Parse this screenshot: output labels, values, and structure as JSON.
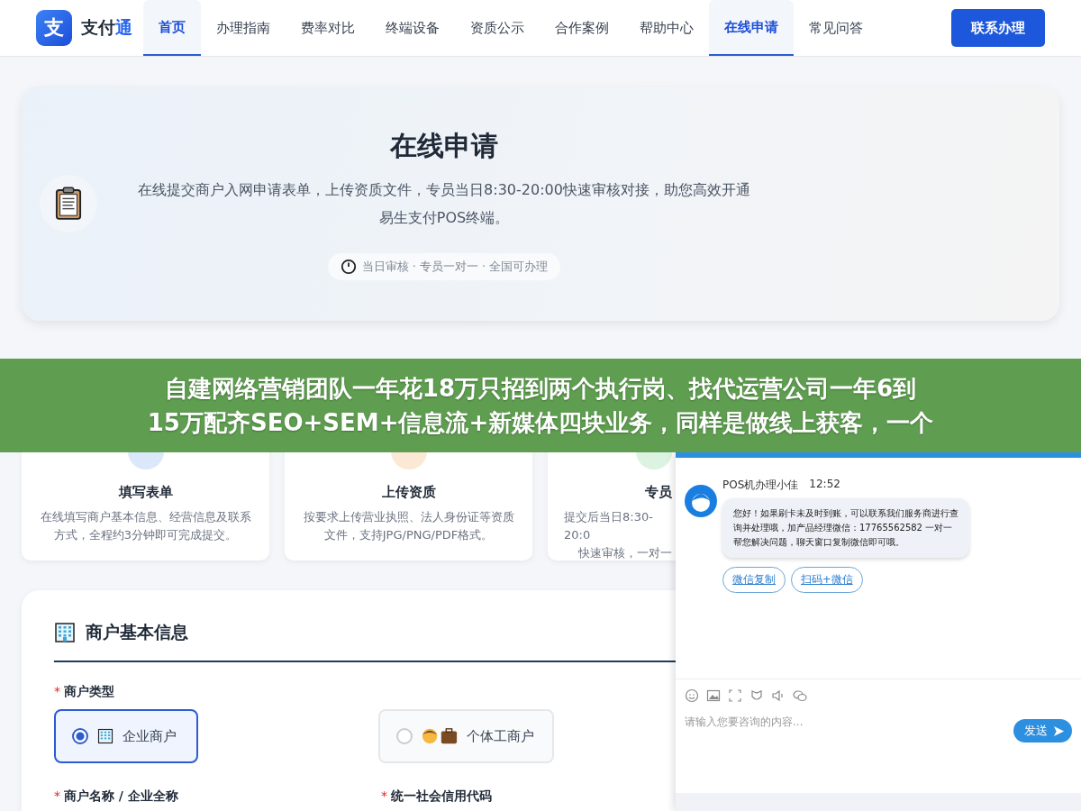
{
  "header": {
    "logo_mark": "支",
    "brand": "支付",
    "brand_accent": "通",
    "nav": [
      {
        "label": "首页",
        "selected": true
      },
      {
        "label": "办理指南",
        "selected": false
      },
      {
        "label": "费率对比",
        "selected": false
      },
      {
        "label": "终端设备",
        "selected": false
      },
      {
        "label": "资质公示",
        "selected": false
      },
      {
        "label": "合作案例",
        "selected": false
      },
      {
        "label": "帮助中心",
        "selected": false
      },
      {
        "label": "在线申请",
        "selected": true
      },
      {
        "label": "常见问答",
        "selected": false
      }
    ],
    "cta": "联系办理"
  },
  "hero": {
    "title": "在线申请",
    "description": "在线提交商户入网申请表单，上传资质文件，专员当日8:30-20:00快速审核对接，助您高效开通易生支付POS终端。",
    "pill": "当日审核 · 专员一对一 · 全国可办理"
  },
  "process": {
    "steps": [
      {
        "color": "#dbe8fb",
        "title": "填写表单",
        "description": "在线填写商户基本信息、经营信息及联系方式，全程约3分钟即可完成提交。"
      },
      {
        "color": "#fbe9d6",
        "title": "上传资质",
        "description": "按要求上传营业执照、法人身份证等资质文件，支持JPG/PNG/PDF格式。"
      },
      {
        "color": "#dcf3e2",
        "title": "专员",
        "description_lines": [
          "提交后当日8:30-20:0",
          "快速审核，一对一"
        ]
      }
    ]
  },
  "form": {
    "heading": "商户基本信息",
    "fields": [
      {
        "mark": "*",
        "label": "商户类型",
        "options": [
          {
            "label": "企业商户",
            "selected": true
          },
          {
            "label": "个体工商户",
            "selected": false
          }
        ]
      }
    ],
    "next_labels": [
      {
        "mark": "*",
        "label": "商户名称 / 企业全称"
      },
      {
        "mark": "*",
        "label": "统一社会信用代码"
      }
    ]
  },
  "banner": {
    "lines": [
      "自建网络营销团队一年花18万只招到两个执行岗、找代运营公司一年6到",
      "15万配齐SEO+SEM+信息流+新媒体四块业务，同样是做线上获客，一个"
    ]
  },
  "chat": {
    "agent": "POS机办理小佳",
    "time": "12:52",
    "message": "您好！如果刷卡未及时到账，可以联系我们服务商进行查询并处理哦，加产品经理微信：17765562582 一对一帮您解决问题，聊天窗口复制微信即可哦。",
    "actions": [
      "微信复制",
      "扫码+微信"
    ],
    "placeholder": "请输入您要咨询的内容...",
    "send": "发送"
  }
}
